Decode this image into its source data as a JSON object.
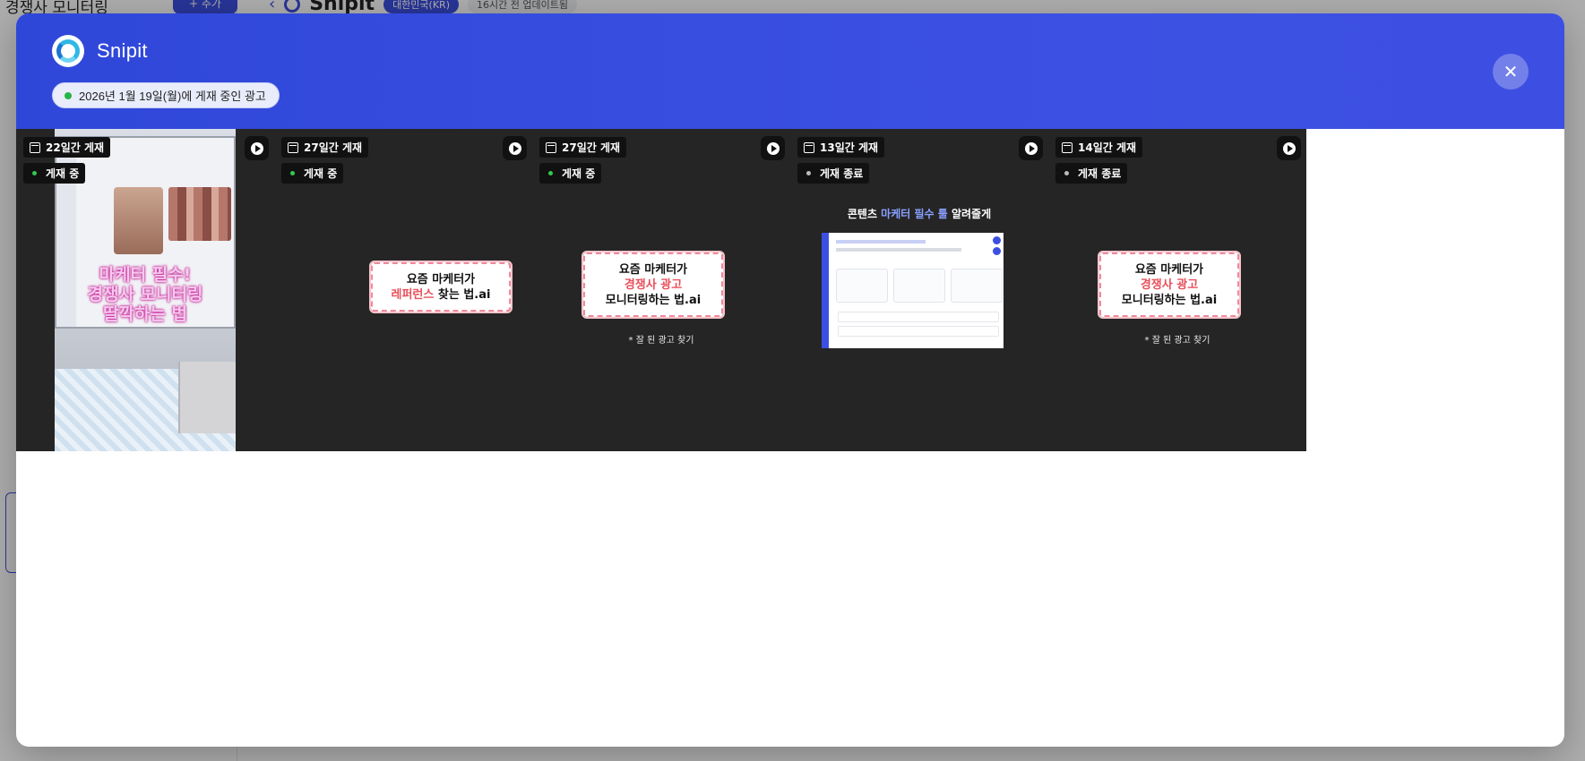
{
  "background": {
    "sidebar_title": "경쟁사 모니터링",
    "add_button": "+ 추가",
    "brand_name": "Snipit",
    "country_badge": "대한민국(KR)",
    "updated_badge": "16시간 전 업데이트됨"
  },
  "modal": {
    "brand_name": "Snipit",
    "live_label": "2026년 1월 19일(월)에 게재 중인 광고",
    "close_icon": "close-icon",
    "accent_color": "#3b50e3",
    "live_color": "#28b446"
  },
  "ads": [
    {
      "days": "22일간 게재",
      "status": "게재 중",
      "active": true,
      "overlay_text": [
        "마케터 필수!",
        "경쟁사 모니터링",
        "딸깍하는 법"
      ]
    },
    {
      "days": "27일간 게재",
      "status": "게재 중",
      "active": true,
      "card_line1": "요즘 마케터가",
      "card_line2_highlight": "레퍼런스",
      "card_line2_rest": " 찾는 법.ai",
      "caption": ""
    },
    {
      "days": "27일간 게재",
      "status": "게재 중",
      "active": true,
      "card_line1": "요즘 마케터가",
      "card_line2_highlight": "경쟁사 광고",
      "card_line3": "모니터링하는 법.ai",
      "caption": "* 잘 된 광고 찾기"
    },
    {
      "days": "13일간 게재",
      "status": "게재 종료",
      "active": false,
      "title_pre": "콘텐츠 ",
      "title_highlight": "마케터 필수 툴",
      "title_post": " 알려줄게"
    },
    {
      "days": "14일간 게재",
      "status": "게재 종료",
      "active": false,
      "card_line1": "요즘 마케터가",
      "card_line2_highlight": "경쟁사 광고",
      "card_line3": "모니터링하는 법.ai",
      "caption": "* 잘 된 광고 찾기"
    }
  ]
}
